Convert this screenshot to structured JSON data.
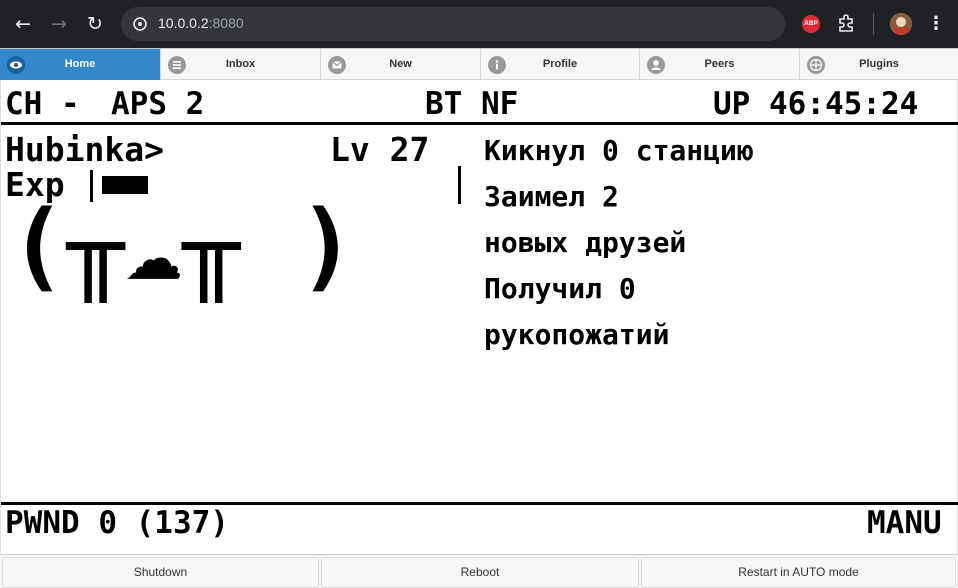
{
  "browser": {
    "url_host": "10.0.0.2",
    "url_port": ":8080",
    "extension_label": "ABP"
  },
  "tabs": [
    {
      "label": "Home",
      "icon": "eye-icon",
      "active": true
    },
    {
      "label": "Inbox",
      "icon": "list-icon",
      "active": false
    },
    {
      "label": "New",
      "icon": "mail-icon",
      "active": false
    },
    {
      "label": "Profile",
      "icon": "info-icon",
      "active": false
    },
    {
      "label": "Peers",
      "icon": "user-icon",
      "active": false
    },
    {
      "label": "Plugins",
      "icon": "grid-icon",
      "active": false
    }
  ],
  "display": {
    "channel": "CH -",
    "aps": "APS 2",
    "bt": "BT NF",
    "uptime": "UP 46:45:24",
    "name": "Hubinka>",
    "level": "Lv 27",
    "exp_label": "Exp",
    "face": "(╥☁╥ )",
    "status_lines": [
      "Кикнул 0 станцию",
      "Заимел 2",
      "новых друзей",
      "Получил 0",
      "рукопожатий"
    ],
    "pwnd": "PWND 0 (137)",
    "mode": "MANU"
  },
  "buttons": {
    "shutdown": "Shutdown",
    "reboot": "Reboot",
    "restart_auto": "Restart in AUTO mode"
  }
}
